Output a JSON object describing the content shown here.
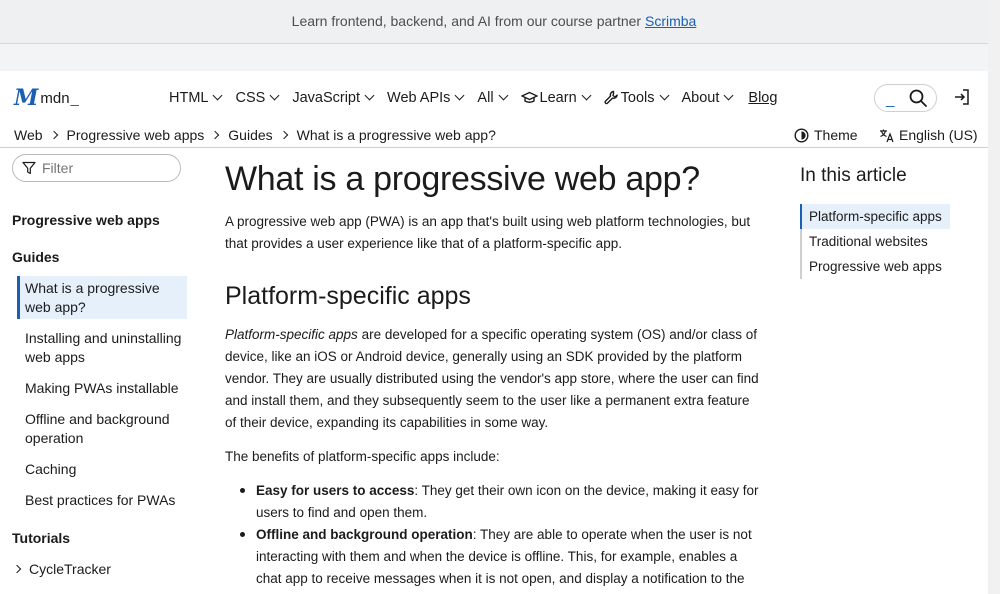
{
  "banner": {
    "text": "Learn frontend, backend, and AI from our course partner ",
    "link": "Scrimba"
  },
  "logo": {
    "mark": "M",
    "text": "mdn",
    "cursor": "_"
  },
  "nav": {
    "items": [
      {
        "label": "HTML"
      },
      {
        "label": "CSS"
      },
      {
        "label": "JavaScript"
      },
      {
        "label": "Web APIs"
      },
      {
        "label": "All"
      },
      {
        "label": "Learn",
        "icon": "graduation-cap-icon"
      },
      {
        "label": "Tools",
        "icon": "wrench-icon"
      },
      {
        "label": "About"
      }
    ],
    "blog": "Blog",
    "search_cursor": "_"
  },
  "breadcrumbs": [
    "Web",
    "Progressive web apps",
    "Guides",
    "What is a progressive web app?"
  ],
  "theme_label": "Theme",
  "language_label": "English (US)",
  "sidebar": {
    "filter_placeholder": "Filter",
    "section_title": "Progressive web apps",
    "guides_heading": "Guides",
    "guides": [
      "What is a progressive web app?",
      "Installing and uninstalling web apps",
      "Making PWAs installable",
      "Offline and background operation",
      "Caching",
      "Best practices for PWAs"
    ],
    "tutorials_heading": "Tutorials",
    "tutorials": [
      "CycleTracker"
    ]
  },
  "article": {
    "title": "What is a progressive web app?",
    "intro": "A progressive web app (PWA) is an app that's built using web platform technologies, but that provides a user experience like that of a platform-specific app.",
    "h2": "Platform-specific apps",
    "p1_em": "Platform-specific apps",
    "p1_rest": " are developed for a specific operating system (OS) and/or class of device, like an iOS or Android device, generally using an SDK provided by the platform vendor. They are usually distributed using the vendor's app store, where the user can find and install them, and they subsequently seem to the user like a permanent extra feature of their device, expanding its capabilities in some way.",
    "p2": "The benefits of platform-specific apps include:",
    "bullets": [
      {
        "strong": "Easy for users to access",
        "rest": ": They get their own icon on the device, making it easy for users to find and open them."
      },
      {
        "strong": "Offline and background operation",
        "rest": ": They are able to operate when the user is not interacting with them and when the device is offline. This, for example, enables a chat app to receive messages when it is not open, and display a notification to the user. It"
      }
    ]
  },
  "toc": {
    "heading": "In this article",
    "items": [
      "Platform-specific apps",
      "Traditional websites",
      "Progressive web apps"
    ]
  }
}
